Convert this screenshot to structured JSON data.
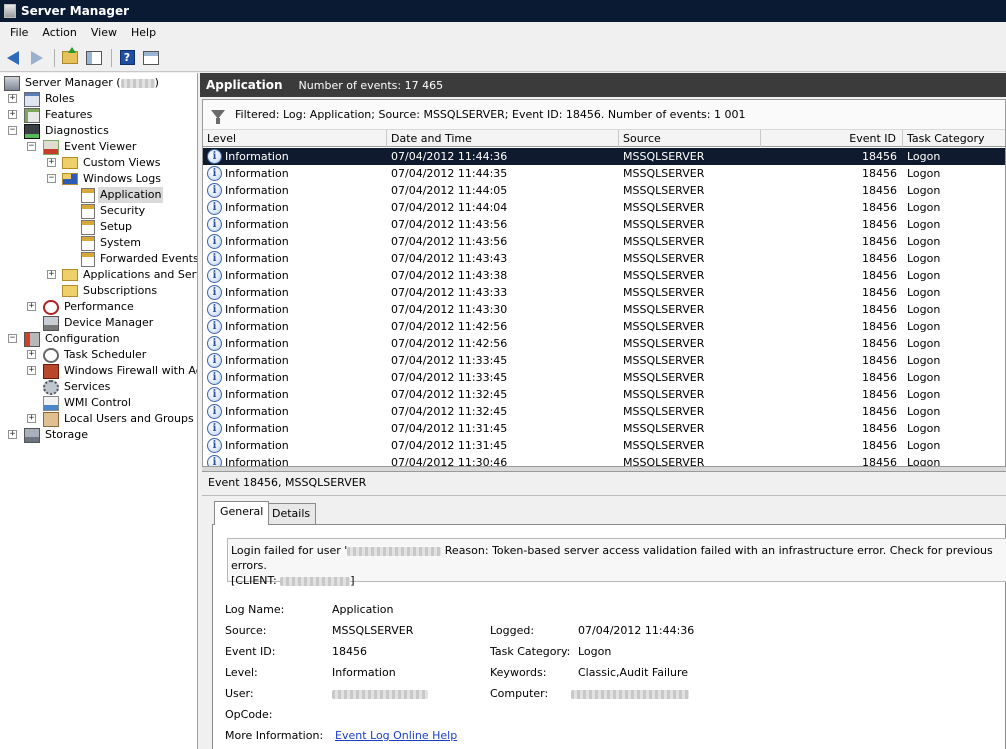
{
  "window": {
    "title": "Server Manager"
  },
  "menu": {
    "items": [
      "File",
      "Action",
      "View",
      "Help"
    ]
  },
  "toolbar": {
    "help_glyph": "?"
  },
  "tree": {
    "root": "Server Manager (",
    "root_suffix": ")",
    "items": {
      "roles": "Roles",
      "features": "Features",
      "diagnostics": "Diagnostics",
      "event_viewer": "Event Viewer",
      "custom_views": "Custom Views",
      "windows_logs": "Windows Logs",
      "application": "Application",
      "security": "Security",
      "setup": "Setup",
      "system": "System",
      "forwarded_events": "Forwarded Events",
      "apps_services": "Applications and Servic",
      "subscriptions": "Subscriptions",
      "performance": "Performance",
      "device_manager": "Device Manager",
      "configuration": "Configuration",
      "task_scheduler": "Task Scheduler",
      "firewall": "Windows Firewall with Adva",
      "services": "Services",
      "wmi": "WMI Control",
      "local_users": "Local Users and Groups",
      "storage": "Storage"
    },
    "toggle_plus": "+",
    "toggle_minus": "−"
  },
  "header": {
    "title": "Application",
    "count": "Number of events: 17 465"
  },
  "filter": {
    "text": "Filtered: Log: Application; Source: MSSQLSERVER; Event ID: 18456. Number of events: 1 001"
  },
  "columns": {
    "level": "Level",
    "datetime": "Date and Time",
    "source": "Source",
    "event_id": "Event ID",
    "task_category": "Task Category"
  },
  "info_glyph": "i",
  "events": [
    {
      "level": "Information",
      "datetime": "07/04/2012 11:44:36",
      "source": "MSSQLSERVER",
      "event_id": "18456",
      "category": "Logon"
    },
    {
      "level": "Information",
      "datetime": "07/04/2012 11:44:35",
      "source": "MSSQLSERVER",
      "event_id": "18456",
      "category": "Logon"
    },
    {
      "level": "Information",
      "datetime": "07/04/2012 11:44:05",
      "source": "MSSQLSERVER",
      "event_id": "18456",
      "category": "Logon"
    },
    {
      "level": "Information",
      "datetime": "07/04/2012 11:44:04",
      "source": "MSSQLSERVER",
      "event_id": "18456",
      "category": "Logon"
    },
    {
      "level": "Information",
      "datetime": "07/04/2012 11:43:56",
      "source": "MSSQLSERVER",
      "event_id": "18456",
      "category": "Logon"
    },
    {
      "level": "Information",
      "datetime": "07/04/2012 11:43:56",
      "source": "MSSQLSERVER",
      "event_id": "18456",
      "category": "Logon"
    },
    {
      "level": "Information",
      "datetime": "07/04/2012 11:43:43",
      "source": "MSSQLSERVER",
      "event_id": "18456",
      "category": "Logon"
    },
    {
      "level": "Information",
      "datetime": "07/04/2012 11:43:38",
      "source": "MSSQLSERVER",
      "event_id": "18456",
      "category": "Logon"
    },
    {
      "level": "Information",
      "datetime": "07/04/2012 11:43:33",
      "source": "MSSQLSERVER",
      "event_id": "18456",
      "category": "Logon"
    },
    {
      "level": "Information",
      "datetime": "07/04/2012 11:43:30",
      "source": "MSSQLSERVER",
      "event_id": "18456",
      "category": "Logon"
    },
    {
      "level": "Information",
      "datetime": "07/04/2012 11:42:56",
      "source": "MSSQLSERVER",
      "event_id": "18456",
      "category": "Logon"
    },
    {
      "level": "Information",
      "datetime": "07/04/2012 11:42:56",
      "source": "MSSQLSERVER",
      "event_id": "18456",
      "category": "Logon"
    },
    {
      "level": "Information",
      "datetime": "07/04/2012 11:33:45",
      "source": "MSSQLSERVER",
      "event_id": "18456",
      "category": "Logon"
    },
    {
      "level": "Information",
      "datetime": "07/04/2012 11:33:45",
      "source": "MSSQLSERVER",
      "event_id": "18456",
      "category": "Logon"
    },
    {
      "level": "Information",
      "datetime": "07/04/2012 11:32:45",
      "source": "MSSQLSERVER",
      "event_id": "18456",
      "category": "Logon"
    },
    {
      "level": "Information",
      "datetime": "07/04/2012 11:32:45",
      "source": "MSSQLSERVER",
      "event_id": "18456",
      "category": "Logon"
    },
    {
      "level": "Information",
      "datetime": "07/04/2012 11:31:45",
      "source": "MSSQLSERVER",
      "event_id": "18456",
      "category": "Logon"
    },
    {
      "level": "Information",
      "datetime": "07/04/2012 11:31:45",
      "source": "MSSQLSERVER",
      "event_id": "18456",
      "category": "Logon"
    },
    {
      "level": "Information",
      "datetime": "07/04/2012 11:30:46",
      "source": "MSSQLSERVER",
      "event_id": "18456",
      "category": "Logon"
    }
  ],
  "selected_row": 0,
  "details": {
    "title": "Event 18456, MSSQLSERVER",
    "tabs": {
      "general": "General",
      "details": "Details"
    },
    "message": {
      "part1": "Login failed for user '",
      "part2": " Reason: Token-based server access validation failed with an infrastructure error. Check for previous errors.",
      "part3": "[CLIENT: ",
      "part4": "]"
    },
    "labels": {
      "log_name": "Log Name:",
      "source": "Source:",
      "event_id": "Event ID:",
      "level": "Level:",
      "user": "User:",
      "opcode": "OpCode:",
      "more_info": "More Information:",
      "logged": "Logged:",
      "task_category": "Task Category:",
      "keywords": "Keywords:",
      "computer": "Computer:"
    },
    "values": {
      "log_name": "Application",
      "source": "MSSQLSERVER",
      "event_id": "18456",
      "level": "Information",
      "more_info_link": "Event Log Online Help",
      "logged": "07/04/2012 11:44:36",
      "task_category": "Logon",
      "keywords": "Classic,Audit Failure"
    }
  },
  "colors": {
    "title_bg": "#0a1a33",
    "header_bg": "#3b3b3b",
    "selection": "#0f1a2e",
    "link": "#1a3fc8"
  }
}
